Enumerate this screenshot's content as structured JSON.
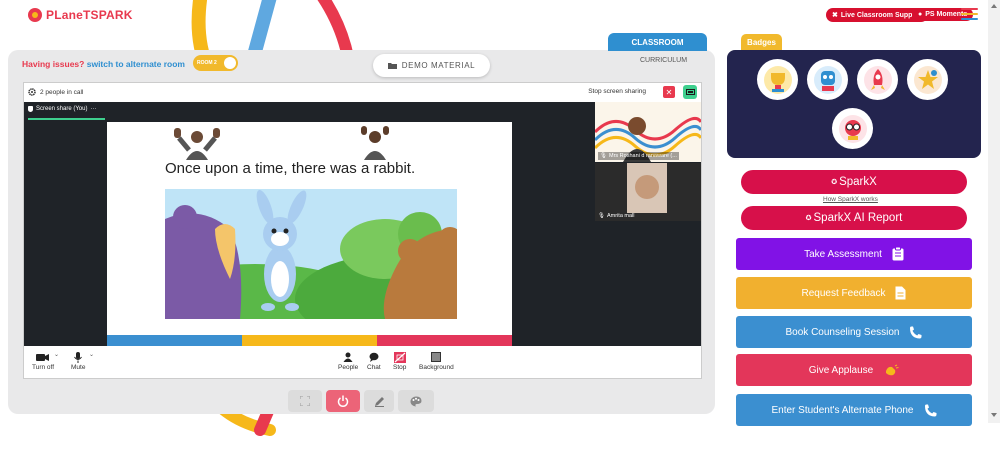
{
  "header": {
    "logo_text": "PLaneTSPARK",
    "live_support_label": "Live Classroom Support",
    "ps_moments_label": "PS Moments"
  },
  "room_panel": {
    "issues_text": "Having issues?",
    "alternate_link": "switch to alternate room",
    "room_toggle_label": "ROOM 2",
    "demo_material_label": "DEMO MATERIAL",
    "classroom_tab": "CLASSROOM",
    "curriculum_tab": "CURRICULUM"
  },
  "call": {
    "people_in_call": "2 people in call",
    "stop_sharing": "Stop screen sharing",
    "screen_share_label": "Screen share (You)",
    "slide_text": "Once upon a time, there was a rabbit.",
    "participants": [
      {
        "name": "Mrs Roshani d ranaware (...",
        "muted": true
      },
      {
        "name": "Amrita mall",
        "muted": true
      }
    ],
    "controls": {
      "turn_off": "Turn off",
      "mute": "Mute",
      "people": "People",
      "chat": "Chat",
      "stop": "Stop",
      "background": "Background"
    }
  },
  "right_panel": {
    "badges_tab": "Badges",
    "badges": [
      "trophy-badge",
      "mascot-badge",
      "rocket-badge",
      "star-badge",
      "glasses-badge"
    ],
    "sparkx_label": "SparkX",
    "how_sparkx_works": "How SparkX works",
    "sparkx_report_label": "SparkX AI Report",
    "actions": [
      {
        "label": "Take Assessment",
        "icon": "clipboard-icon",
        "color": "#8112e6"
      },
      {
        "label": "Request Feedback",
        "icon": "document-icon",
        "color": "#f1b02f"
      },
      {
        "label": "Book Counseling Session",
        "icon": "phone-icon",
        "color": "#3b8fd0"
      },
      {
        "label": "Give Applause",
        "icon": "clap-icon",
        "color": "#e3365a"
      },
      {
        "label": "Enter Student's Alternate Phone",
        "icon": "phone-icon",
        "color": "#3b8fd0"
      }
    ]
  },
  "colors": {
    "brand_red": "#e8394e",
    "brand_yellow": "#f1b92c",
    "brand_blue": "#2f8fd0",
    "navy": "#23244e"
  }
}
